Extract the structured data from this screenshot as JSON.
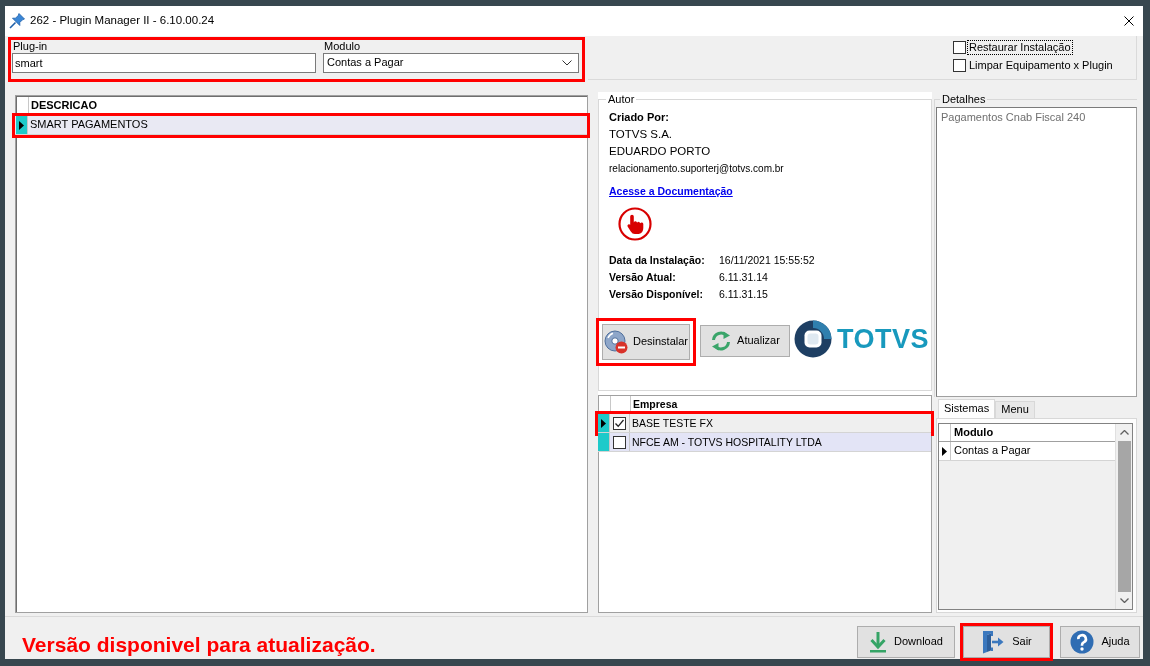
{
  "window": {
    "title": "262 - Plugin Manager II - 6.10.00.24"
  },
  "filters": {
    "highlighted": true,
    "fields": [
      {
        "kind": "text",
        "label": "Plug-in",
        "value": "smart"
      },
      {
        "kind": "dropdown",
        "label": "Modulo",
        "value": "Contas a Pagar"
      }
    ]
  },
  "options": [
    {
      "label": "Restaurar Instalação",
      "checked": false,
      "focused": true
    },
    {
      "label": "Limpar Equipamento x Plugin",
      "checked": false,
      "focused": false
    }
  ],
  "plugins_grid": {
    "columns": [
      "DESCRICAO"
    ],
    "rows": [
      {
        "descricao": "SMART PAGAMENTOS",
        "selected": true,
        "highlighted": true
      }
    ]
  },
  "author": {
    "legend": "Autor",
    "created_by_label": "Criado Por:",
    "company": "TOTVS S.A.",
    "name": "EDUARDO PORTO",
    "email": "relacionamento.suporterj@totvs.com.br",
    "doc_link": "Acesse a Documentação",
    "info": [
      {
        "label": "Data da Instalação:",
        "value": "16/11/2021 15:55:52"
      },
      {
        "label": "Versão Atual:",
        "value": "6.11.31.14"
      },
      {
        "label": "Versão Disponível:",
        "value": "6.11.31.15"
      }
    ]
  },
  "actions": [
    {
      "kind": "uninstall",
      "label": "Desinstalar",
      "highlighted": true
    },
    {
      "kind": "update",
      "label": "Atualizar",
      "highlighted": false
    }
  ],
  "logo": {
    "text": "TOTVS"
  },
  "companies_grid": {
    "columns": [
      "Empresa"
    ],
    "rows": [
      {
        "empresa": "BASE TESTE FX",
        "checked": true,
        "selected": true,
        "highlighted": true
      },
      {
        "empresa": "NFCE AM - TOTVS HOSPITALITY LTDA",
        "checked": false,
        "selected": false,
        "highlighted": false
      }
    ]
  },
  "details": {
    "legend": "Detalhes",
    "value": "Pagamentos Cnab Fiscal 240",
    "disabled": true
  },
  "tabs": [
    {
      "label": "Sistemas",
      "selected": true
    },
    {
      "label": "Menu",
      "selected": false
    }
  ],
  "systems_grid": {
    "columns": [
      "Modulo"
    ],
    "rows": [
      {
        "modulo": "Contas a Pagar",
        "selected": true
      }
    ]
  },
  "status_message": "Versão disponivel para atualização.",
  "footer_buttons": [
    {
      "kind": "download",
      "label": "Download",
      "highlighted": false
    },
    {
      "kind": "exit",
      "label": "Sair",
      "highlighted": true
    },
    {
      "kind": "help",
      "label": "Ajuda",
      "highlighted": false
    }
  ]
}
